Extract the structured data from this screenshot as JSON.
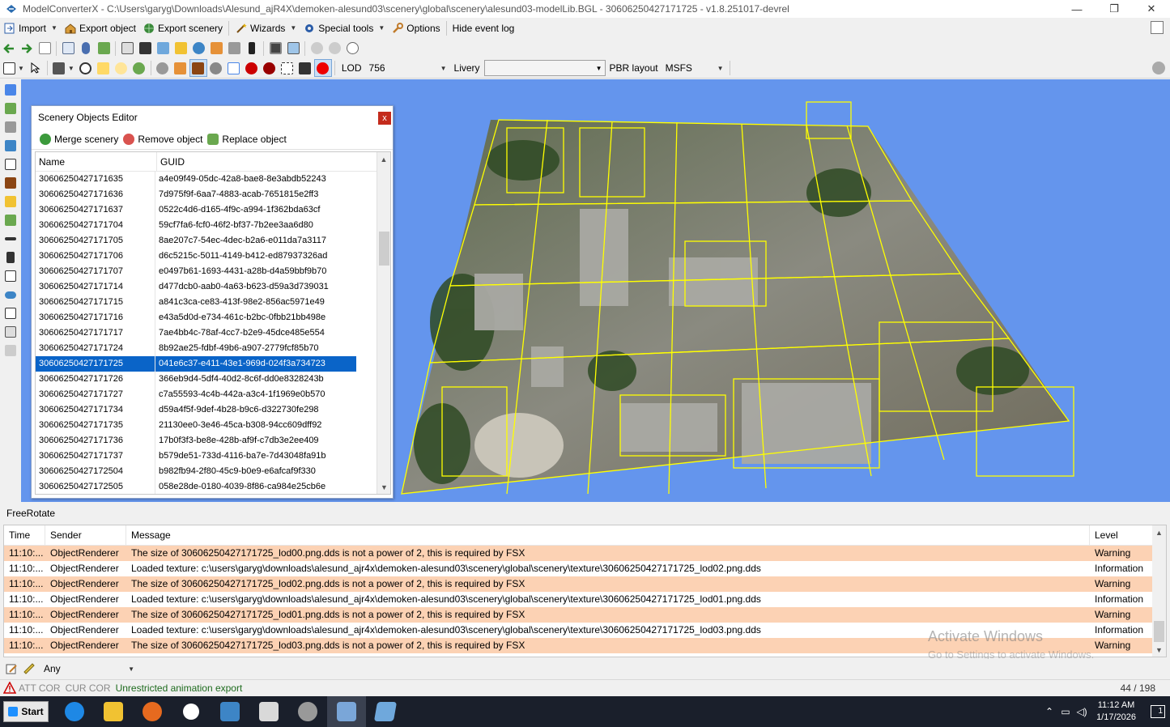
{
  "window": {
    "title": "ModelConverterX - C:\\Users\\garyg\\Downloads\\Alesund_ajR4X\\demoken-alesund03\\scenery\\global\\scenery\\alesund03-modelLib.BGL - 30606250427171725 - v1.8.251017-devrel",
    "minimize": "—",
    "maximize": "❐",
    "close": "✕"
  },
  "menu": {
    "import": "Import",
    "export_object": "Export object",
    "export_scenery": "Export scenery",
    "wizards": "Wizards",
    "special_tools": "Special tools",
    "options": "Options",
    "hide_event_log": "Hide event log"
  },
  "toolbar3": {
    "lod_label": "LOD",
    "lod_value": "756",
    "livery_label": "Livery",
    "livery_value": "",
    "pbr_label": "PBR layout",
    "pbr_value": "MSFS"
  },
  "editor": {
    "title": "Scenery Objects Editor",
    "close": "x",
    "merge": "Merge scenery",
    "remove": "Remove object",
    "replace": "Replace object",
    "col_name": "Name",
    "col_guid": "GUID",
    "rows": [
      {
        "name": "30606250427171635",
        "guid": "a4e09f49-05dc-42a8-bae8-8e3abdb52243"
      },
      {
        "name": "30606250427171636",
        "guid": "7d975f9f-6aa7-4883-acab-7651815e2ff3"
      },
      {
        "name": "30606250427171637",
        "guid": "0522c4d6-d165-4f9c-a994-1f362bda63cf"
      },
      {
        "name": "30606250427171704",
        "guid": "59cf7fa6-fcf0-46f2-bf37-7b2ee3aa6d80"
      },
      {
        "name": "30606250427171705",
        "guid": "8ae207c7-54ec-4dec-b2a6-e011da7a3117"
      },
      {
        "name": "30606250427171706",
        "guid": "d6c5215c-5011-4149-b412-ed87937326ad"
      },
      {
        "name": "30606250427171707",
        "guid": "e0497b61-1693-4431-a28b-d4a59bbf9b70"
      },
      {
        "name": "30606250427171714",
        "guid": "d477dcb0-aab0-4a63-b623-d59a3d739031"
      },
      {
        "name": "30606250427171715",
        "guid": "a841c3ca-ce83-413f-98e2-856ac5971e49"
      },
      {
        "name": "30606250427171716",
        "guid": "e43a5d0d-e734-461c-b2bc-0fbb21bb498e"
      },
      {
        "name": "30606250427171717",
        "guid": "7ae4bb4c-78af-4cc7-b2e9-45dce485e554"
      },
      {
        "name": "30606250427171724",
        "guid": "8b92ae25-fdbf-49b6-a907-2779fcf85b70"
      },
      {
        "name": "30606250427171725",
        "guid": "041e6c37-e411-43e1-969d-024f3a734723",
        "selected": true
      },
      {
        "name": "30606250427171726",
        "guid": "366eb9d4-5df4-40d2-8c6f-dd0e8328243b"
      },
      {
        "name": "30606250427171727",
        "guid": "c7a55593-4c4b-442a-a3c4-1f1969e0b570"
      },
      {
        "name": "30606250427171734",
        "guid": "d59a4f5f-9def-4b28-b9c6-d322730fe298"
      },
      {
        "name": "30606250427171735",
        "guid": "21130ee0-3e46-45ca-b308-94cc609dff92"
      },
      {
        "name": "30606250427171736",
        "guid": "17b0f3f3-be8e-428b-af9f-c7db3e2ee409"
      },
      {
        "name": "30606250427171737",
        "guid": "b579de51-733d-4116-ba7e-7d43048fa91b"
      },
      {
        "name": "30606250427172504",
        "guid": "b982fb94-2f80-45c9-b0e9-e6afcaf9f330"
      },
      {
        "name": "30606250427172505",
        "guid": "058e28de-0180-4039-8f86-ca984e25cb6e"
      }
    ]
  },
  "freerotate": "FreeRotate",
  "log": {
    "col_time": "Time",
    "col_sender": "Sender",
    "col_message": "Message",
    "col_level": "Level",
    "rows": [
      {
        "time": "11:10:...",
        "sender": "ObjectRenderer",
        "message": "The size of 30606250427171725_lod00.png.dds is not a power of 2, this is required by FSX",
        "level": "Warning"
      },
      {
        "time": "11:10:...",
        "sender": "ObjectRenderer",
        "message": "Loaded texture: c:\\users\\garyg\\downloads\\alesund_ajr4x\\demoken-alesund03\\scenery\\global\\scenery\\texture\\30606250427171725_lod02.png.dds",
        "level": "Information"
      },
      {
        "time": "11:10:...",
        "sender": "ObjectRenderer",
        "message": "The size of 30606250427171725_lod02.png.dds is not a power of 2, this is required by FSX",
        "level": "Warning"
      },
      {
        "time": "11:10:...",
        "sender": "ObjectRenderer",
        "message": "Loaded texture: c:\\users\\garyg\\downloads\\alesund_ajr4x\\demoken-alesund03\\scenery\\global\\scenery\\texture\\30606250427171725_lod01.png.dds",
        "level": "Information"
      },
      {
        "time": "11:10:...",
        "sender": "ObjectRenderer",
        "message": "The size of 30606250427171725_lod01.png.dds is not a power of 2, this is required by FSX",
        "level": "Warning"
      },
      {
        "time": "11:10:...",
        "sender": "ObjectRenderer",
        "message": "Loaded texture: c:\\users\\garyg\\downloads\\alesund_ajr4x\\demoken-alesund03\\scenery\\global\\scenery\\texture\\30606250427171725_lod03.png.dds",
        "level": "Information"
      },
      {
        "time": "11:10:...",
        "sender": "ObjectRenderer",
        "message": "The size of 30606250427171725_lod03.png.dds is not a power of 2, this is required by FSX",
        "level": "Warning"
      }
    ],
    "watermark_title": "Activate Windows",
    "watermark_sub": "Go to Settings to activate Windows."
  },
  "filter": {
    "value": "Any"
  },
  "status": {
    "att_cor": "ATT COR",
    "cur_cor": "CUR COR",
    "message": "Unrestricted animation export",
    "count": "44 / 198"
  },
  "taskbar": {
    "start": "Start",
    "time": "11:12 AM",
    "date": "1/17/2026",
    "notifications": "1"
  },
  "colors": {
    "viewport_bg": "#6495ed",
    "selection": "#0a64c8",
    "warning_row": "#fcd2b4",
    "wireframe": "#ffff00"
  }
}
